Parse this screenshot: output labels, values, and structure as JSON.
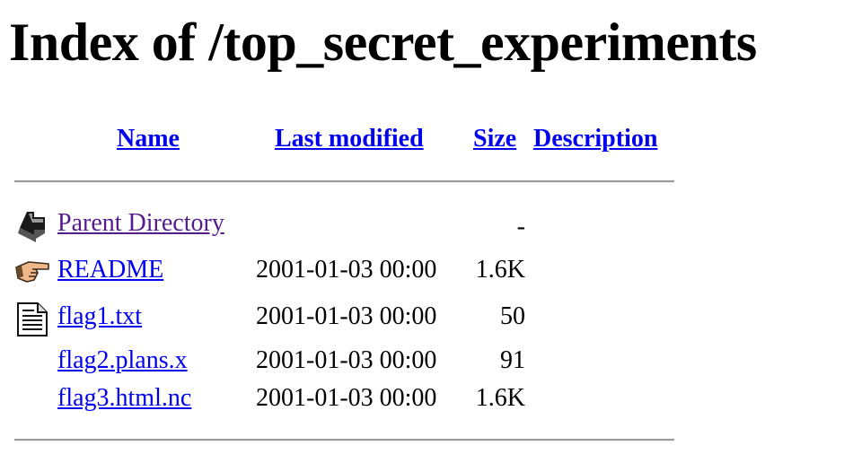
{
  "page": {
    "title": "Index of /top_secret_experiments"
  },
  "columns": {
    "name": "Name",
    "last_modified": "Last modified",
    "size": "Size",
    "description": "Description"
  },
  "rows": [
    {
      "icon": "back-arrow-icon",
      "name": "Parent Directory",
      "date": "",
      "size": "-"
    },
    {
      "icon": "pointing-hand-icon",
      "name": "README",
      "date": "2001-01-03 00:00",
      "size": "1.6K"
    },
    {
      "icon": "text-file-icon",
      "name": "flag1.txt",
      "date": "2001-01-03 00:00",
      "size": "50"
    },
    {
      "icon": "",
      "name": "flag2.plans.x",
      "date": "2001-01-03 00:00",
      "size": "91"
    },
    {
      "icon": "",
      "name": "flag3.html.nc",
      "date": "2001-01-03 00:00",
      "size": "1.6K"
    }
  ],
  "colors": {
    "link": "#0000ee",
    "visited_link": "#551a8b"
  }
}
